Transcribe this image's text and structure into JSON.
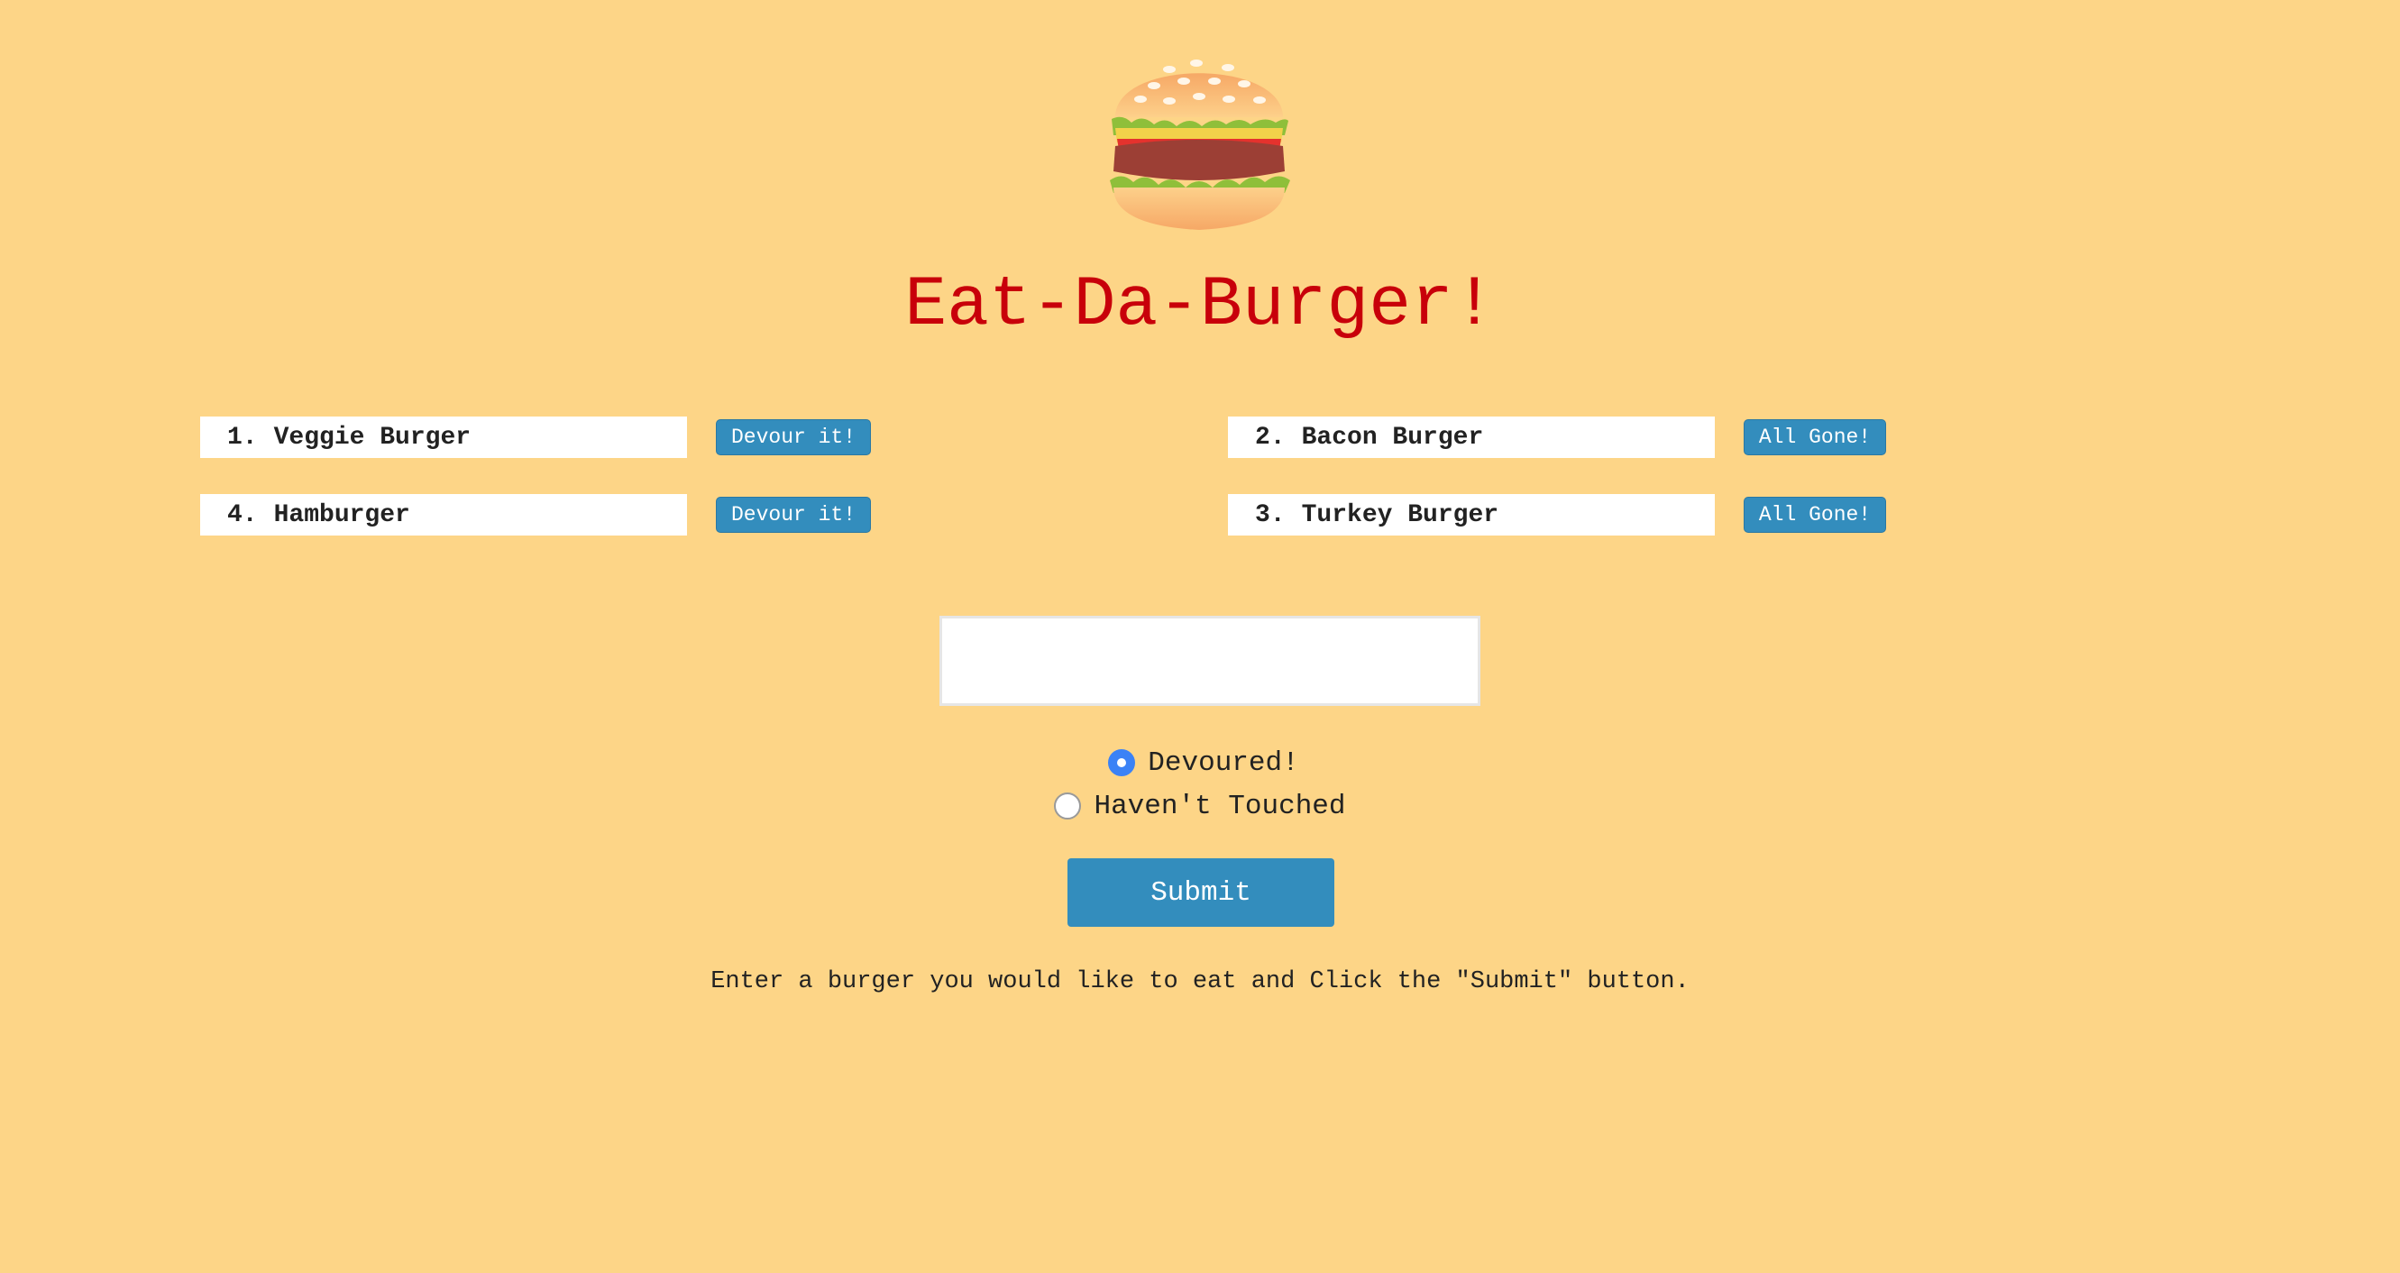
{
  "page": {
    "title": "Eat-Da-Burger!",
    "background_color": "#fdd587",
    "title_color": "#c8000a",
    "button_color": "#338dbd"
  },
  "logo": {
    "icon": "hamburger-icon"
  },
  "burgers_left": [
    {
      "number": "1.",
      "name": "Veggie Burger",
      "button_label": "Devour it!"
    },
    {
      "number": "4.",
      "name": "Hamburger",
      "button_label": "Devour it!"
    }
  ],
  "burgers_right": [
    {
      "number": "2.",
      "name": "Bacon Burger",
      "button_label": "All Gone!"
    },
    {
      "number": "3.",
      "name": "Turkey Burger",
      "button_label": "All Gone!"
    }
  ],
  "form": {
    "input_value": "",
    "options": [
      {
        "label": "Devoured!",
        "checked": true
      },
      {
        "label": "Haven't Touched",
        "checked": false
      }
    ],
    "submit_label": "Submit"
  },
  "instructions": "Enter a burger you would like to eat and Click the \"Submit\" button."
}
